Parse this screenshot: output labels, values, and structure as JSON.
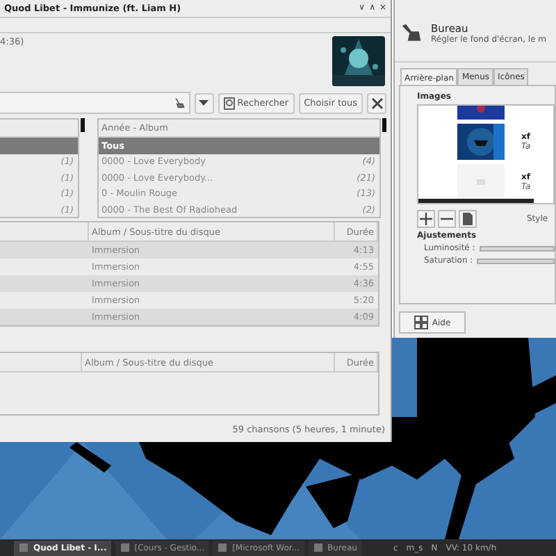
{
  "quodlibet": {
    "title": "Quod Libet - Immunize (ft. Liam H)",
    "window_controls": [
      "∨",
      "∧",
      "×"
    ],
    "now_playing": "4:36)",
    "search": {
      "buttons": [
        "Rechercher",
        "Choisir tous"
      ]
    },
    "artists": {
      "rows": [
        {
          "selected": true
        },
        {
          "count": "(1)",
          "selected": false
        },
        {
          "count": "(1)",
          "selected": false
        },
        {
          "count": "(1)",
          "selected": false
        },
        {
          "count": "(1)",
          "selected": false
        }
      ]
    },
    "albums": {
      "header": "Année - Album",
      "rows": [
        {
          "label": "Tous",
          "selected": true
        },
        {
          "label": "0000 - Love Everybody",
          "count": "(4)",
          "selected": false
        },
        {
          "label": "0000 - Love Everybody...",
          "count": "(21)",
          "selected": false
        },
        {
          "label": "0 - Moulin Rouge",
          "count": "(13)",
          "selected": false
        },
        {
          "label": "0000 - The Best Of Radiohead",
          "count": "(2)",
          "selected": false
        }
      ]
    },
    "songs": {
      "columns": [
        "Album / Sous-titre du disque",
        "Durée"
      ],
      "rows": [
        {
          "album": "Immersion",
          "duration": "4:13"
        },
        {
          "album": "Immersion",
          "duration": "4:55"
        },
        {
          "album": "Immersion",
          "duration": "4:36"
        },
        {
          "album": "Immersion",
          "duration": "5:20"
        },
        {
          "album": "Immersion",
          "duration": "4:09"
        }
      ]
    },
    "queue": {
      "columns": [
        "Album / Sous-titre du disque",
        "Durée"
      ]
    },
    "status": "59 chansons (5 heures, 1 minute)"
  },
  "bureau": {
    "title": "Bureau",
    "subtitle": "Régler le fond d'écran, le m",
    "tabs": [
      {
        "label": "Arrière-plan",
        "selected": true
      },
      {
        "label": "Menus",
        "selected": false
      },
      {
        "label": "Icônes",
        "selected": false
      }
    ],
    "images_label": "Images",
    "images": [
      {
        "name": "xf",
        "detail": "Ta"
      },
      {
        "name": "xf",
        "detail": "Ta"
      }
    ],
    "style_label": "Style",
    "adjustments": {
      "title": "Ajustements",
      "sliders": [
        {
          "label": "Luminosité :",
          "level": 1
        },
        {
          "label": "Saturation :",
          "level": 1
        }
      ]
    },
    "help_button": "Aide"
  },
  "taskbar": {
    "items": [
      {
        "label": "Quod Libet - I...",
        "selected": true
      },
      {
        "label": "[Cours - Gestio...",
        "selected": false
      },
      {
        "label": "[Microsoft Wor...",
        "selected": false
      },
      {
        "label": "Bureau",
        "selected": false
      }
    ],
    "tray": [
      "c",
      "m_s",
      "N",
      "VV: 10 km/h"
    ]
  }
}
